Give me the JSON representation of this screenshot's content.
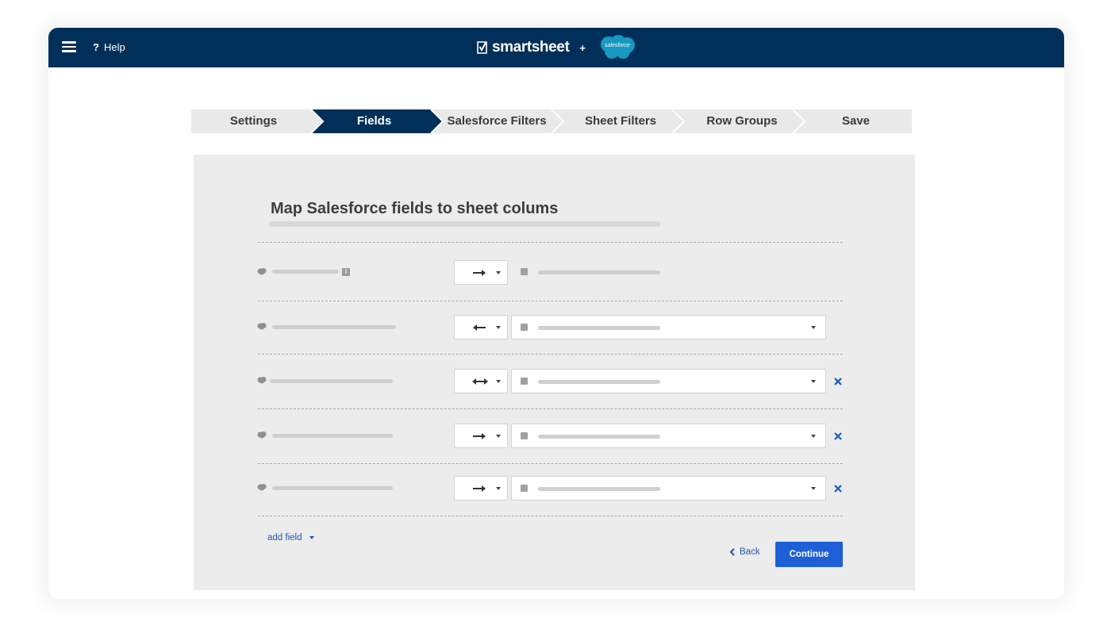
{
  "header": {
    "help_label": "Help",
    "help_icon": "?",
    "brand_name": "smartsheet",
    "plus": "+",
    "partner_name": "salesforce",
    "bg_color": "#003059"
  },
  "steps": [
    {
      "label": "Settings",
      "active": false
    },
    {
      "label": "Fields",
      "active": true
    },
    {
      "label": "Salesforce Filters",
      "active": false
    },
    {
      "label": "Sheet Filters",
      "active": false
    },
    {
      "label": "Row Groups",
      "active": false
    },
    {
      "label": "Save",
      "active": false
    }
  ],
  "panel": {
    "title": "Map Salesforce fields to sheet colums",
    "rows": [
      {
        "direction": "right",
        "column_type": "static",
        "removable": false,
        "info_icon": true
      },
      {
        "direction": "left",
        "column_type": "dropdown",
        "removable": false,
        "info_icon": false
      },
      {
        "direction": "both",
        "column_type": "dropdown",
        "removable": true,
        "info_icon": false
      },
      {
        "direction": "right",
        "column_type": "dropdown",
        "removable": true,
        "info_icon": false
      },
      {
        "direction": "right",
        "column_type": "dropdown",
        "removable": true,
        "info_icon": false
      }
    ],
    "add_field_label": "add field",
    "back_label": "Back",
    "continue_label": "Continue"
  },
  "colors": {
    "active_step": "#003059",
    "accent": "#1f5fd6",
    "link": "#1f56b7"
  },
  "icons": [
    "menu-icon",
    "help-icon",
    "smartsheet-logo-icon",
    "salesforce-cloud-icon",
    "arrow-right-icon",
    "arrow-left-icon",
    "arrow-both-icon",
    "close-icon",
    "chevron-left-icon"
  ]
}
